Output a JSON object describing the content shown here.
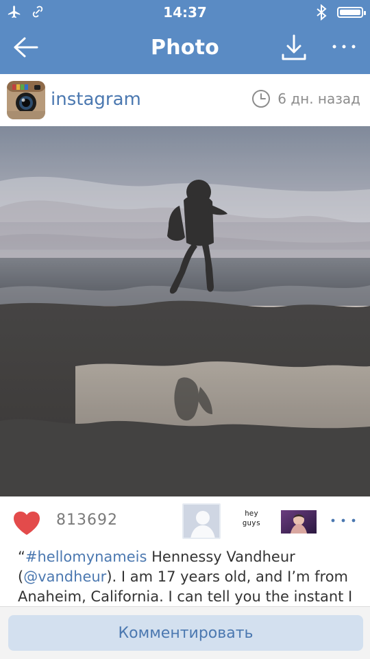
{
  "status_bar": {
    "time": "14:37",
    "icons": [
      "airplane-icon",
      "link-icon",
      "bluetooth-icon",
      "battery-icon"
    ]
  },
  "nav": {
    "title": "Photo",
    "back_icon": "back-arrow-icon",
    "download_icon": "download-icon",
    "more_icon": "more-horizontal-icon"
  },
  "post": {
    "author": "instagram",
    "time_ago": "6 дн. назад",
    "likes": "813692",
    "liker_text": [
      "hey",
      "guys"
    ]
  },
  "caption": {
    "hashtag": "#hellomynameis",
    "part1": " Hennessy Vandheur (",
    "mention": "@vandheur",
    "part2": "). I am 17 years old, and I’m from Anaheim, California. I can tell you the instant I",
    "open_quote": "“"
  },
  "actions": {
    "comment_label": "Комментировать"
  },
  "colors": {
    "accent": "#5a8bc4",
    "link": "#4b78b0",
    "heart": "#e34b4b"
  }
}
